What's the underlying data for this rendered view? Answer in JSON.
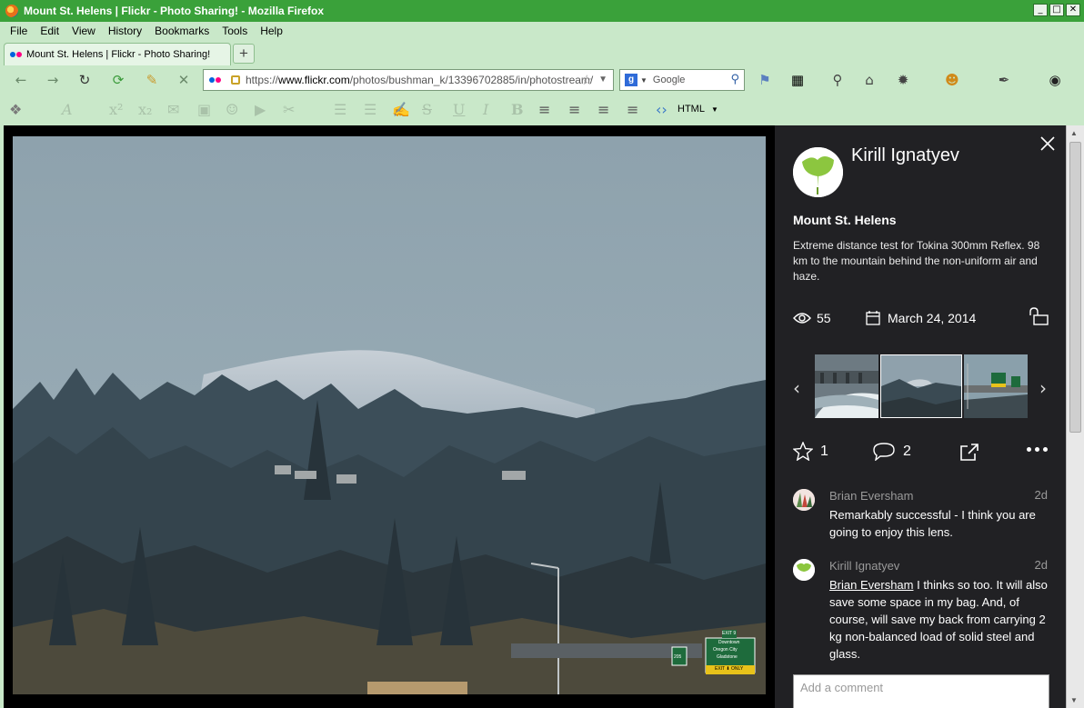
{
  "window": {
    "title": "Mount St. Helens | Flickr - Photo Sharing! - Mozilla Firefox",
    "buttons": [
      "_",
      "□",
      "✕"
    ]
  },
  "menu": [
    "File",
    "Edit",
    "View",
    "History",
    "Bookmarks",
    "Tools",
    "Help"
  ],
  "tabs": [
    {
      "label": "Mount St. Helens | Flickr - Photo Sharing!"
    }
  ],
  "new_tab_label": "+",
  "url": {
    "scheme": "https://",
    "host": "www.flickr.com",
    "path": "/photos/bushman_k/13396702885/in/photostream/"
  },
  "search": {
    "placeholder": "Google"
  },
  "format_toolbar": {
    "html_label": "HTML"
  },
  "sidebar": {
    "owner": "Kirill Ignatyev",
    "photo_title": "Mount St. Helens",
    "description": "Extreme distance test for Tokina 300mm Reflex. 98 km to the mountain behind the non-uniform air and haze.",
    "views": "55",
    "date": "March 24, 2014",
    "faves": "1",
    "comments_count": "2",
    "comments": [
      {
        "author": "Brian Eversham",
        "age": "2d",
        "text": "Remarkably successful - I think you are going to enjoy this lens."
      },
      {
        "author": "Kirill Ignatyev",
        "age": "2d",
        "mention": "Brian Eversham",
        "text": " I thinks so too. It will also save some space in my bag. And, of course, will save my back from carrying 2 kg non-balanced load of solid steel and glass."
      }
    ],
    "add_comment_placeholder": "Add a comment"
  },
  "sign": {
    "line1": "EXIT 9",
    "line2": "Downtown",
    "line3": "Oregon City",
    "line4": "Gladstone",
    "line5": "EXIT ⬇ ONLY",
    "shield": "205"
  },
  "colors": {
    "titlebar": "#3aa13a",
    "chrome": "#c9e8c9",
    "sidebar": "#212124",
    "flickr_blue": "#0063dc",
    "flickr_pink": "#ff0084"
  }
}
